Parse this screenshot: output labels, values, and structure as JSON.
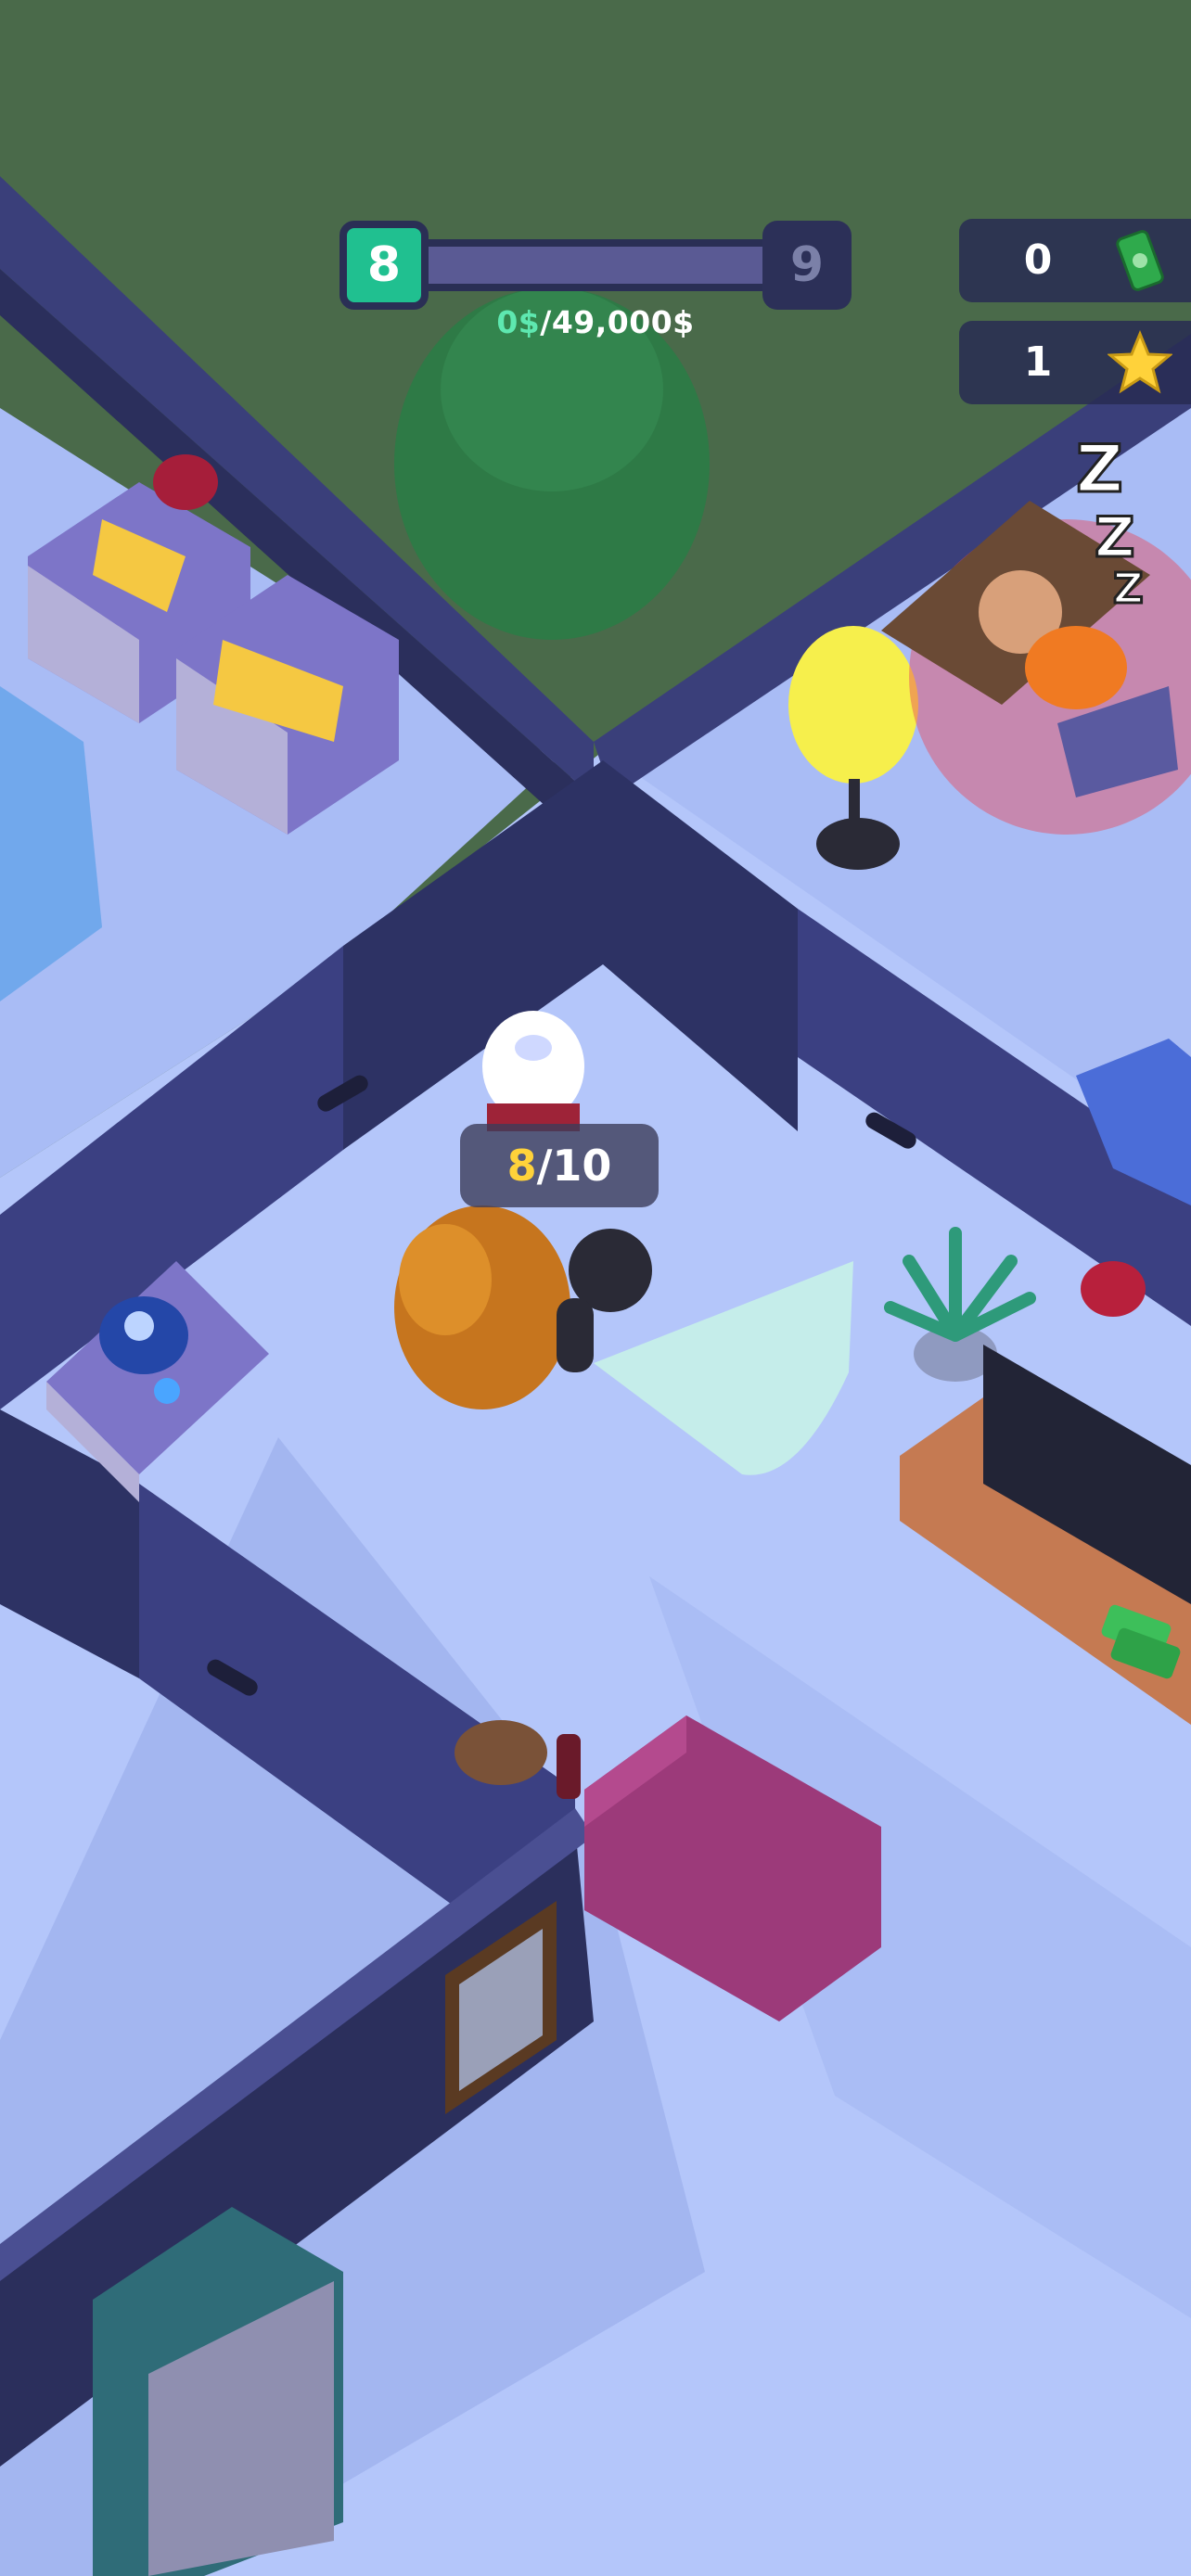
{
  "hud": {
    "level": {
      "current": "8",
      "next": "9",
      "progress": 0.0
    },
    "money": {
      "current": "0$",
      "separator": "/",
      "goal": "49,000$"
    },
    "cash": {
      "value": "0",
      "icon": "cash-icon"
    },
    "stars": {
      "value": "1",
      "icon": "star-icon"
    }
  },
  "loot": {
    "current": "8",
    "separator": "/",
    "max": "10"
  },
  "colors": {
    "accent": "#20c090",
    "star": "#ffd23a",
    "panel": "#2c3058",
    "floor": "#a9bcf5",
    "wall": "#3a3f7a",
    "grass": "#4a6a4a"
  }
}
